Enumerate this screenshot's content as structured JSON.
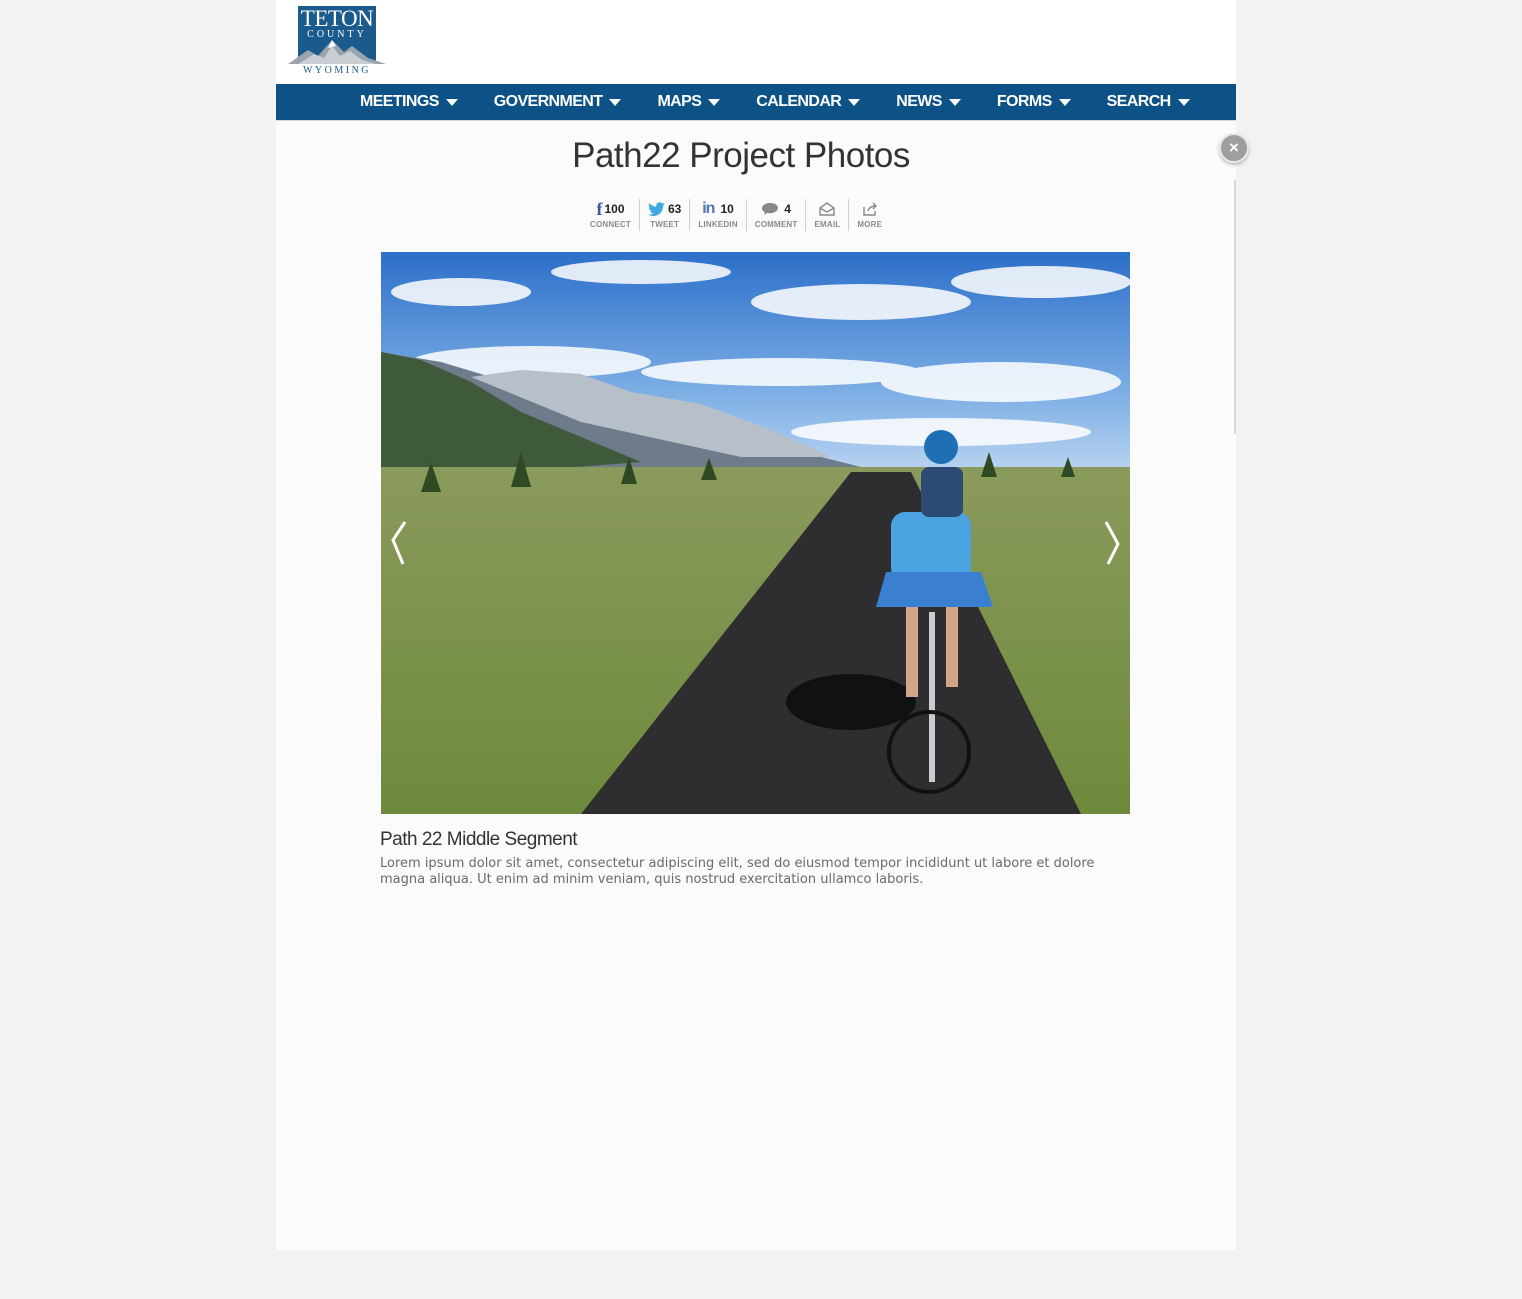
{
  "logo": {
    "line1": "TETON",
    "line2": "COUNTY",
    "line3": "WYOMING"
  },
  "nav": {
    "items": [
      {
        "label": "MEETINGS"
      },
      {
        "label": "GOVERNMENT"
      },
      {
        "label": "MAPS"
      },
      {
        "label": "CALENDAR"
      },
      {
        "label": "NEWS"
      },
      {
        "label": "FORMS"
      },
      {
        "label": "SEARCH"
      }
    ]
  },
  "modal": {
    "title": "Path22 Project Photos",
    "close_label": "×"
  },
  "share": {
    "facebook": {
      "count": "100",
      "label": "CONNECT"
    },
    "twitter": {
      "count": "63",
      "label": "TWEET"
    },
    "linkedin": {
      "count": "10",
      "label": "LINKEDIN"
    },
    "comment": {
      "count": "4",
      "label": "COMMENT"
    },
    "email": {
      "label": "EMAIL"
    },
    "more": {
      "label": "MORE"
    }
  },
  "photo": {
    "caption_title": "Path 22 Middle Segment",
    "caption_text": "Lorem ipsum dolor sit amet, consectetur adipiscing elit, sed do eiusmod tempor incididunt ut labore et dolore magna aliqua. Ut enim ad minim veniam, quis nostrud exercitation ullamco laboris."
  },
  "colors": {
    "brand": "#0d5286",
    "background": "#f2f2f2"
  }
}
